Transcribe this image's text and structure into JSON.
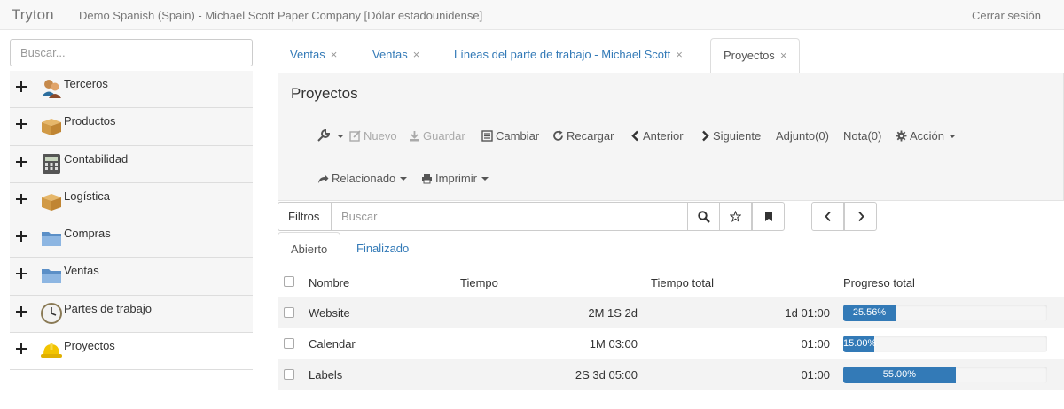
{
  "navbar": {
    "brand": "Tryton",
    "company": "Demo Spanish (Spain) - Michael Scott Paper Company [Dólar estadounidense]",
    "logout": "Cerrar sesión"
  },
  "sidebar": {
    "search_placeholder": "Buscar...",
    "items": [
      {
        "label": "Terceros",
        "icon": "users-icon"
      },
      {
        "label": "Productos",
        "icon": "box-icon"
      },
      {
        "label": "Contabilidad",
        "icon": "calculator-icon"
      },
      {
        "label": "Logística",
        "icon": "box-icon"
      },
      {
        "label": "Compras",
        "icon": "folder-icon"
      },
      {
        "label": "Ventas",
        "icon": "folder-icon"
      },
      {
        "label": "Partes de trabajo",
        "icon": "clock-icon"
      },
      {
        "label": "Proyectos",
        "icon": "hardhat-icon"
      }
    ]
  },
  "tabs": [
    {
      "label": "Ventas",
      "close": "×"
    },
    {
      "label": "Ventas",
      "close": "×"
    },
    {
      "label": "Líneas del parte de trabajo - Michael Scott",
      "close": "×"
    },
    {
      "label": "Proyectos",
      "close": "×"
    }
  ],
  "panel": {
    "title": "Proyectos",
    "toolbar": {
      "new": "Nuevo",
      "save": "Guardar",
      "switch": "Cambiar",
      "reload": "Recargar",
      "previous": "Anterior",
      "next": "Siguiente",
      "attachment": "Adjunto(0)",
      "note": "Nota(0)",
      "action": "Acción",
      "related": "Relacionado",
      "print": "Imprimir"
    }
  },
  "filter": {
    "button": "Filtros",
    "placeholder": "Buscar"
  },
  "subtabs": [
    "Abierto",
    "Finalizado"
  ],
  "grid": {
    "columns": [
      "Nombre",
      "Tiempo",
      "Tiempo total",
      "Progreso total"
    ],
    "rows": [
      {
        "name": "Website",
        "time": "2M 1S 2d",
        "total_time": "1d 01:00",
        "progress": 25.56,
        "progress_label": "25.56%"
      },
      {
        "name": "Calendar",
        "time": "1M 03:00",
        "total_time": "01:00",
        "progress": 15.0,
        "progress_label": "15.00%"
      },
      {
        "name": "Labels",
        "time": "2S 3d 05:00",
        "total_time": "01:00",
        "progress": 55.0,
        "progress_label": "55.00%"
      }
    ]
  },
  "colors": {
    "accent": "#337ab7",
    "progress": "#337ab7"
  }
}
